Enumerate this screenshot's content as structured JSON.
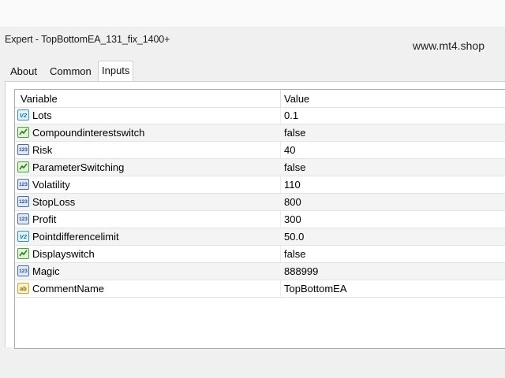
{
  "window": {
    "title": "Expert - TopBottomEA_131_fix_1400+"
  },
  "watermark": "www.mt4.shop",
  "tabs": [
    {
      "label": "About",
      "active": false
    },
    {
      "label": "Common",
      "active": false
    },
    {
      "label": "Inputs",
      "active": true
    }
  ],
  "table": {
    "headers": {
      "variable": "Variable",
      "value": "Value"
    },
    "rows": [
      {
        "icon": "double-type-icon",
        "variable": "Lots",
        "value": "0.1"
      },
      {
        "icon": "bool-type-icon",
        "variable": "Compoundinterestswitch",
        "value": "false"
      },
      {
        "icon": "int-type-icon",
        "variable": "Risk",
        "value": "40"
      },
      {
        "icon": "bool-type-icon",
        "variable": "ParameterSwitching",
        "value": "false"
      },
      {
        "icon": "int-type-icon",
        "variable": "Volatility",
        "value": "110"
      },
      {
        "icon": "int-type-icon",
        "variable": "StopLoss",
        "value": "800"
      },
      {
        "icon": "int-type-icon",
        "variable": "Profit",
        "value": "300"
      },
      {
        "icon": "double-type-icon",
        "variable": "Pointdifferencelimit",
        "value": "50.0"
      },
      {
        "icon": "bool-type-icon",
        "variable": "Displayswitch",
        "value": "false"
      },
      {
        "icon": "int-type-icon",
        "variable": "Magic",
        "value": "888999"
      },
      {
        "icon": "string-type-icon",
        "variable": "CommentName",
        "value": "TopBottomEA"
      }
    ]
  },
  "icon_glyphs": {
    "double": "V2",
    "int": "123",
    "string": "ab"
  }
}
